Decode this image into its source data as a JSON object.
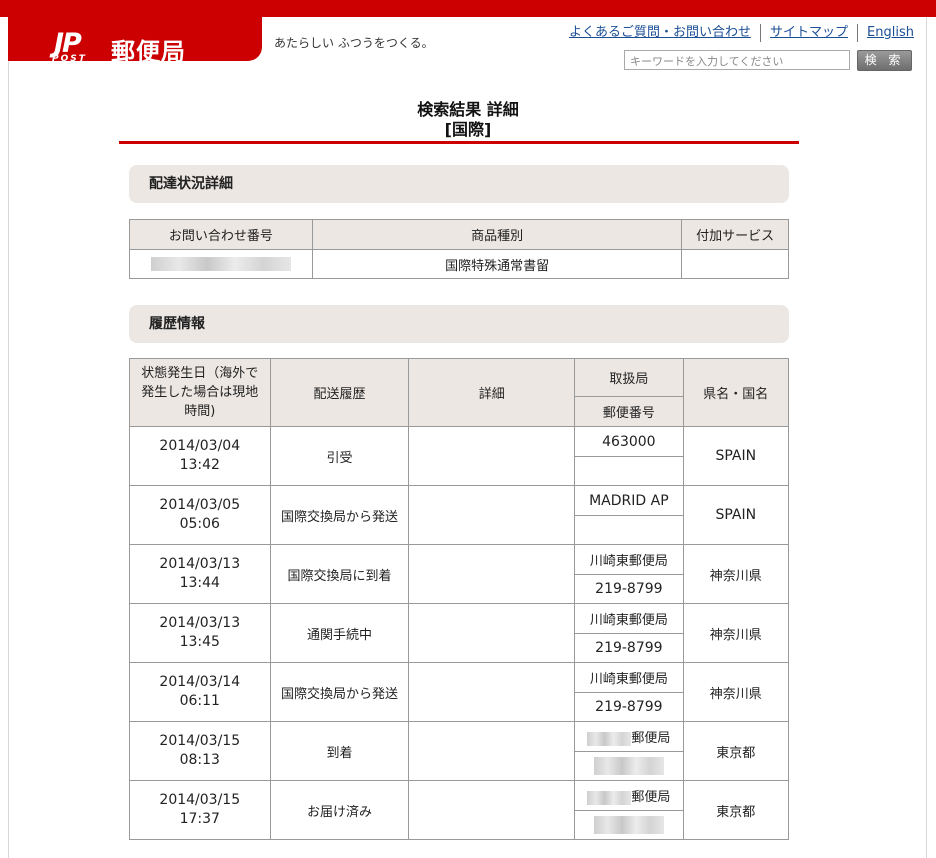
{
  "header": {
    "logo_mark": "JP",
    "logo_post": "POST",
    "logo_text": "郵便局",
    "tagline": "あたらしい ふつうをつくる。",
    "links": [
      "よくあるご質問・お問い合わせ",
      "サイトマップ",
      "English"
    ],
    "search_placeholder": "キーワードを入力してください",
    "search_button": "検 索"
  },
  "page": {
    "title": "検索結果 詳細",
    "subtitle": "[国際]"
  },
  "delivery_section": {
    "heading": "配達状況詳細",
    "columns": [
      "お問い合わせ番号",
      "商品種別",
      "付加サービス"
    ],
    "row": {
      "tracking_number": "",
      "product_type": "国際特殊通常書留",
      "additional_service": ""
    }
  },
  "history_section": {
    "heading": "履歴情報",
    "columns": {
      "date": "状態発生日（海外で発生した場合は現地時間)",
      "status": "配送履歴",
      "detail": "詳細",
      "office": "取扱局",
      "postal_code": "郵便番号",
      "region": "県名・国名"
    },
    "rows": [
      {
        "date": "2014/03/04",
        "time": "13:42",
        "status": "引受",
        "detail": "",
        "office": "463000",
        "postal": "",
        "region": "SPAIN"
      },
      {
        "date": "2014/03/05",
        "time": "05:06",
        "status": "国際交換局から発送",
        "detail": "",
        "office": "MADRID AP",
        "postal": "",
        "region": "SPAIN"
      },
      {
        "date": "2014/03/13",
        "time": "13:44",
        "status": "国際交換局に到着",
        "detail": "",
        "office": "川崎東郵便局",
        "postal": "219-8799",
        "region": "神奈川県"
      },
      {
        "date": "2014/03/13",
        "time": "13:45",
        "status": "通関手続中",
        "detail": "",
        "office": "川崎東郵便局",
        "postal": "219-8799",
        "region": "神奈川県"
      },
      {
        "date": "2014/03/14",
        "time": "06:11",
        "status": "国際交換局から発送",
        "detail": "",
        "office": "川崎東郵便局",
        "postal": "219-8799",
        "region": "神奈川県"
      },
      {
        "date": "2014/03/15",
        "time": "08:13",
        "status": "到着",
        "detail": "",
        "office": "郵便局",
        "postal": "",
        "region": "東京都"
      },
      {
        "date": "2014/03/15",
        "time": "17:37",
        "status": "お届け済み",
        "detail": "",
        "office": "郵便局",
        "postal": "",
        "region": "東京都"
      }
    ]
  },
  "colors": {
    "brand_red": "#cc0000",
    "header_bg": "#ece7e3",
    "link": "#1a4e96"
  }
}
